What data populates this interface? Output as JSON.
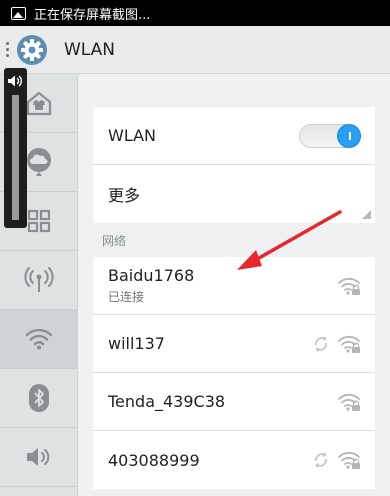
{
  "statusbar": {
    "text": "正在保存屏幕截图..."
  },
  "actionbar": {
    "title": "WLAN"
  },
  "sidebar": {
    "items": [
      {
        "icon": "home-icon"
      },
      {
        "icon": "cloud-icon"
      },
      {
        "icon": "apps-grid-icon"
      },
      {
        "icon": "wireless-tower-icon"
      },
      {
        "icon": "wifi-icon",
        "active": true
      },
      {
        "icon": "bluetooth-icon"
      },
      {
        "icon": "volume-icon"
      }
    ]
  },
  "volume_overlay": {
    "icon": "speaker-icon"
  },
  "settings": {
    "wlan_label": "WLAN",
    "wlan_enabled": true,
    "more_label": "更多"
  },
  "networks_section": {
    "label": "网络",
    "networks": [
      {
        "name": "Baidu1768",
        "status": "已连接",
        "wps": false
      },
      {
        "name": "will137",
        "status": "",
        "wps": true
      },
      {
        "name": "Tenda_439C38",
        "status": "",
        "wps": false
      },
      {
        "name": "403088999",
        "status": "",
        "wps": true
      }
    ]
  },
  "colors": {
    "accent": "#2a9df4",
    "arrow": "#e8262d"
  }
}
